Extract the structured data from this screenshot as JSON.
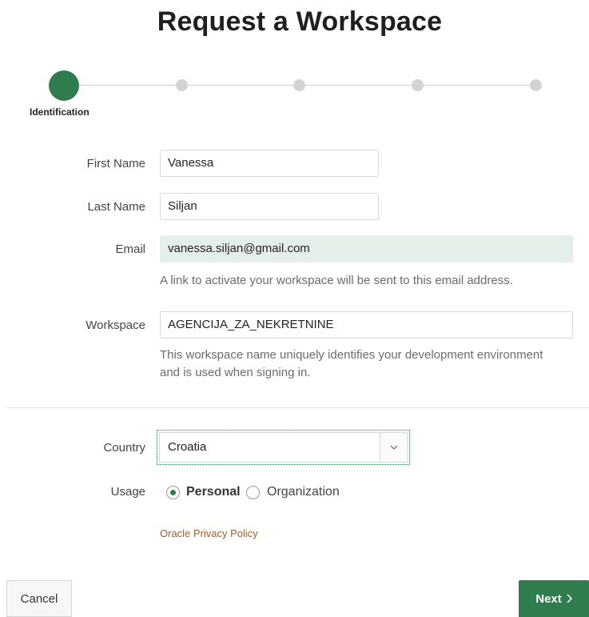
{
  "page": {
    "title": "Request a Workspace"
  },
  "progress": {
    "active_step_label": "Identification",
    "steps_total": 5,
    "current_step": 1
  },
  "form": {
    "first_name": {
      "label": "First Name",
      "value": "Vanessa"
    },
    "last_name": {
      "label": "Last Name",
      "value": "Siljan"
    },
    "email": {
      "label": "Email",
      "value": "vanessa.siljan@gmail.com",
      "help": "A link to activate your workspace will be sent to this email address."
    },
    "workspace": {
      "label": "Workspace",
      "value": "AGENCIJA_ZA_NEKRETNINE",
      "help_line1": "This workspace name uniquely identifies your development environment",
      "help_line2": "and is used when signing in."
    },
    "country": {
      "label": "Country",
      "value": "Croatia",
      "icon": "chevron-down-icon"
    },
    "usage": {
      "label": "Usage",
      "options": [
        "Personal",
        "Organization"
      ],
      "selected": "Personal"
    },
    "privacy_link": "Oracle Privacy Policy"
  },
  "buttons": {
    "cancel": "Cancel",
    "next": "Next",
    "next_icon": "chevron-right-icon"
  },
  "colors": {
    "accent": "#2f7d4f",
    "readonly_bg": "#e5efe9",
    "link": "#a35d2a"
  }
}
